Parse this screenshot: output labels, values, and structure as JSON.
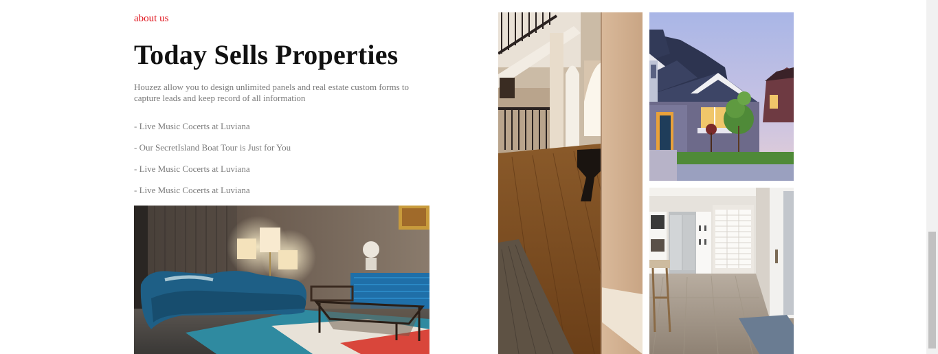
{
  "about": {
    "link_label": "about us",
    "title": "Today Sells Properties",
    "intro": "Houzez allow you to design unlimited panels and real estate custom forms to capture leads and keep record of all information",
    "features": [
      "- Live Music Cocerts at Luviana",
      "- Our SecretIsland Boat Tour is Just for You",
      "- Live Music Cocerts at Luviana",
      "- Live Music Cocerts at Luviana"
    ]
  },
  "gallery": {
    "images": [
      {
        "subject": "living-room-blue-sofa"
      },
      {
        "subject": "hallway-staircase-wood-floor"
      },
      {
        "subject": "suburban-house-dusk"
      },
      {
        "subject": "white-kitchen-interior"
      }
    ]
  },
  "colors": {
    "accent": "#e0121b",
    "title": "#111111",
    "body_text": "#7b7b7b"
  }
}
